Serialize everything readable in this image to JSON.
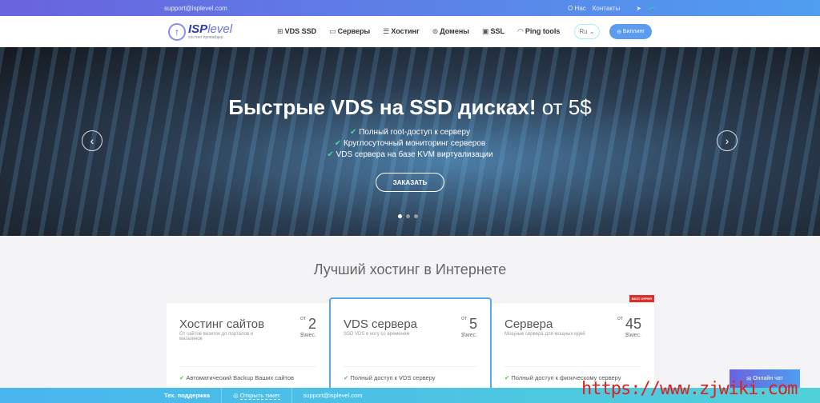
{
  "topbar": {
    "email": "support@isplevel.com",
    "about": "О Нас",
    "contacts": "Контакты"
  },
  "logo": {
    "brand": "ISP",
    "brand2": "level",
    "tagline": "хостинг провайдер"
  },
  "menu": [
    {
      "label": "VDS SSD",
      "icon": "network-icon"
    },
    {
      "label": "Серверы",
      "icon": "monitor-icon"
    },
    {
      "label": "Хостинг",
      "icon": "server-icon"
    },
    {
      "label": "Домены",
      "icon": "globe-icon"
    },
    {
      "label": "SSL",
      "icon": "certificate-icon"
    },
    {
      "label": "Ping tools",
      "icon": "gauge-icon"
    }
  ],
  "lang": "Ru",
  "billing": "Биллинг",
  "hero": {
    "title": "Быстрые VDS на SSD дисках!",
    "title_price": "от 5$",
    "features": [
      "Полный root-доступ к серверу",
      "Круглосуточный мониторинг серверов",
      "VDS сервера на базе KVM виртуализации"
    ],
    "order": "ЗАКАЗАТЬ",
    "slides": 3,
    "active_slide": 1
  },
  "section_title": "Лучший хостинг в Интернете",
  "cards": [
    {
      "title": "Хостинг сайтов",
      "subtitle": "От сайтов визиток до порталов и магазинов",
      "from": "от",
      "price": "2",
      "unit": "$\\мес.",
      "feature": "Автоматический Backup Ваших сайтов"
    },
    {
      "title": "VDS сервера",
      "subtitle": "SSD VDS в ногу со временем",
      "from": "от",
      "price": "5",
      "unit": "$\\мес.",
      "feature": "Полный доступ к VDS серверу"
    },
    {
      "title": "Сервера",
      "subtitle": "Мощные сервера для мощных идей",
      "from": "от",
      "price": "45",
      "unit": "$\\мес.",
      "feature": "Полный доступ к физическому серверу",
      "badge": "BEST OFFER"
    }
  ],
  "footer": {
    "support": "Тех. поддержка",
    "ticket": "Открыть тикет",
    "email": "support@isplevel.com"
  },
  "chat": "Онлайн чат",
  "watermark": "https://www.zjwiki.com",
  "colors": {
    "accent": "#5b9cf0",
    "gradient_start": "#6a63de",
    "check": "#5ac25a"
  }
}
